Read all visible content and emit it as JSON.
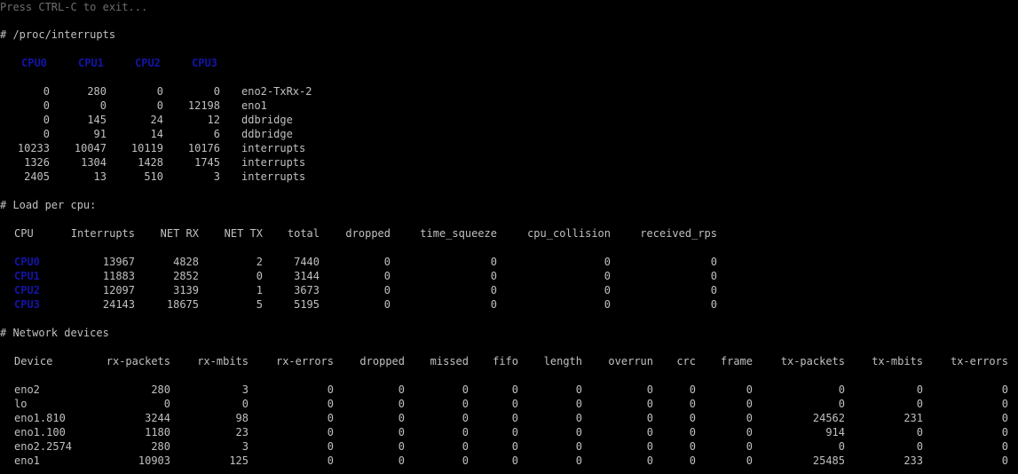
{
  "header": {
    "exit_hint": "Press CTRL-C to exit..."
  },
  "colors": {
    "background": "#000000",
    "text": "#c0c0c0",
    "dim_text": "#6e6e6e",
    "cpu_label": "#1414a8"
  },
  "interrupts": {
    "title": "# /proc/interrupts",
    "cpu_headers": [
      "CPU0",
      "CPU1",
      "CPU2",
      "CPU3"
    ],
    "rows": [
      {
        "values": [
          "0",
          "280",
          "0",
          "0"
        ],
        "name": "eno2-TxRx-2"
      },
      {
        "values": [
          "0",
          "0",
          "0",
          "12198"
        ],
        "name": "eno1"
      },
      {
        "values": [
          "0",
          "145",
          "24",
          "12"
        ],
        "name": "ddbridge"
      },
      {
        "values": [
          "0",
          "91",
          "14",
          "6"
        ],
        "name": "ddbridge"
      },
      {
        "values": [
          "10233",
          "10047",
          "10119",
          "10176"
        ],
        "name": "interrupts"
      },
      {
        "values": [
          "1326",
          "1304",
          "1428",
          "1745"
        ],
        "name": "interrupts"
      },
      {
        "values": [
          "2405",
          "13",
          "510",
          "3"
        ],
        "name": "interrupts"
      }
    ]
  },
  "load": {
    "title": "# Load per cpu:",
    "headers": [
      "CPU",
      "Interrupts",
      "NET RX",
      "NET TX",
      "total",
      "dropped",
      "time_squeeze",
      "cpu_collision",
      "received_rps"
    ],
    "rows": [
      [
        "CPU0",
        "13967",
        "4828",
        "2",
        "7440",
        "0",
        "0",
        "0",
        "0"
      ],
      [
        "CPU1",
        "11883",
        "2852",
        "0",
        "3144",
        "0",
        "0",
        "0",
        "0"
      ],
      [
        "CPU2",
        "12097",
        "3139",
        "1",
        "3673",
        "0",
        "0",
        "0",
        "0"
      ],
      [
        "CPU3",
        "24143",
        "18675",
        "5",
        "5195",
        "0",
        "0",
        "0",
        "0"
      ]
    ]
  },
  "network": {
    "title": "# Network devices",
    "headers": [
      "Device",
      "rx-packets",
      "rx-mbits",
      "rx-errors",
      "dropped",
      "missed",
      "fifo",
      "length",
      "overrun",
      "crc",
      "frame",
      "tx-packets",
      "tx-mbits",
      "tx-errors"
    ],
    "rows": [
      [
        "eno2",
        "280",
        "3",
        "0",
        "0",
        "0",
        "0",
        "0",
        "0",
        "0",
        "0",
        "0",
        "0",
        "0"
      ],
      [
        "lo",
        "0",
        "0",
        "0",
        "0",
        "0",
        "0",
        "0",
        "0",
        "0",
        "0",
        "0",
        "0",
        "0"
      ],
      [
        "eno1.810",
        "3244",
        "98",
        "0",
        "0",
        "0",
        "0",
        "0",
        "0",
        "0",
        "0",
        "24562",
        "231",
        "0"
      ],
      [
        "eno1.100",
        "1180",
        "23",
        "0",
        "0",
        "0",
        "0",
        "0",
        "0",
        "0",
        "0",
        "914",
        "0",
        "0"
      ],
      [
        "eno2.2574",
        "280",
        "3",
        "0",
        "0",
        "0",
        "0",
        "0",
        "0",
        "0",
        "0",
        "0",
        "0",
        "0"
      ],
      [
        "eno1",
        "10903",
        "125",
        "0",
        "0",
        "0",
        "0",
        "0",
        "0",
        "0",
        "0",
        "25485",
        "233",
        "0"
      ]
    ]
  }
}
